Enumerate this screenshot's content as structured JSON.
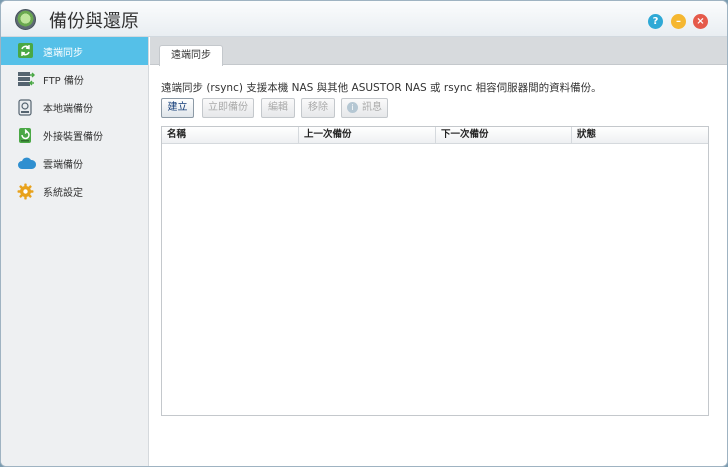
{
  "window": {
    "title": "備份與還原"
  },
  "sidebar": {
    "items": [
      {
        "label": "遠端同步",
        "icon": "sync-icon"
      },
      {
        "label": "FTP 備份",
        "icon": "ftp-icon"
      },
      {
        "label": "本地端備份",
        "icon": "local-drive-icon"
      },
      {
        "label": "外接裝置備份",
        "icon": "external-drive-icon"
      },
      {
        "label": "雲端備份",
        "icon": "cloud-icon"
      },
      {
        "label": "系統設定",
        "icon": "gear-icon"
      }
    ],
    "active_index": 0
  },
  "main": {
    "tabs": [
      {
        "label": "遠端同步"
      }
    ],
    "description": "遠端同步 (rsync) 支援本機 NAS 與其他 ASUSTOR NAS 或 rsync 相容伺服器間的資料備份。",
    "toolbar": {
      "create_label": "建立",
      "backup_now_label": "立即備份",
      "edit_label": "編輯",
      "remove_label": "移除",
      "info_label": "訊息"
    },
    "table": {
      "columns": [
        "名稱",
        "上一次備份",
        "下一次備份",
        "狀態"
      ],
      "rows": []
    }
  },
  "colors": {
    "accent": "#55c0e8",
    "help": "#2fa9d6",
    "minimize": "#f5b731",
    "close": "#e55a4a"
  }
}
